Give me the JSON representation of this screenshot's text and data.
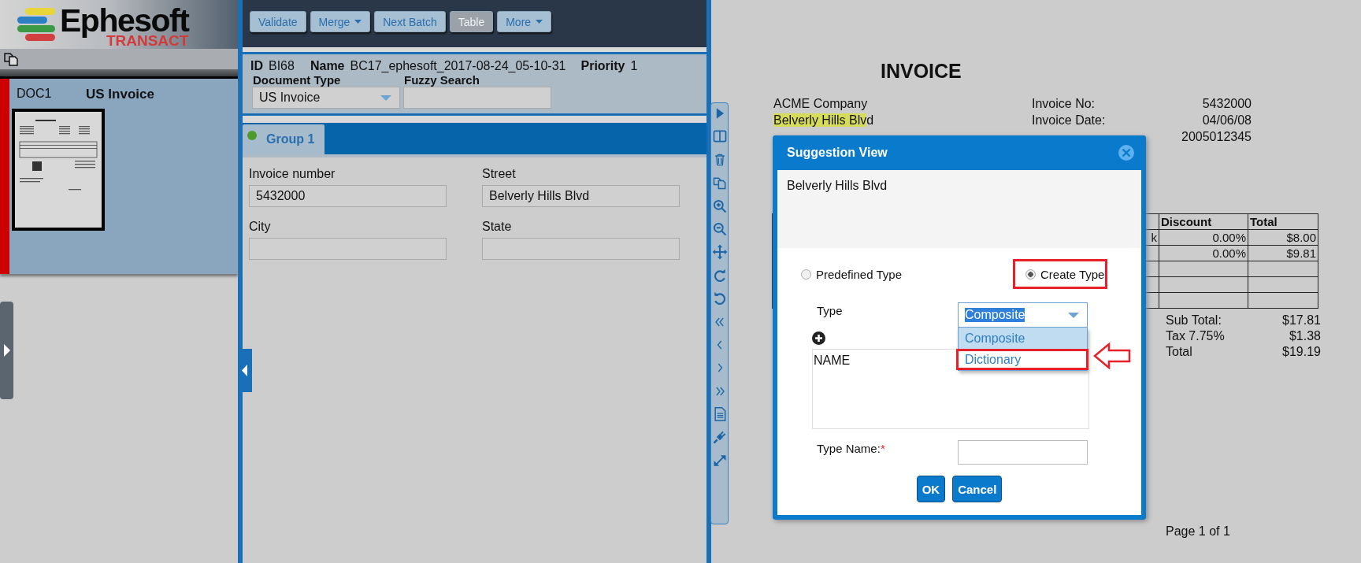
{
  "logo": {
    "name": "Ephesoft",
    "product": "TRANSACT"
  },
  "documents": [
    {
      "id": "DOC1",
      "type": "US Invoice",
      "selected": true
    }
  ],
  "toolbar": {
    "buttons": [
      {
        "label": "Validate",
        "dropdown": false,
        "disabled": false
      },
      {
        "label": "Merge",
        "dropdown": true,
        "disabled": false
      },
      {
        "label": "Next Batch",
        "dropdown": false,
        "disabled": false
      },
      {
        "label": "Table",
        "dropdown": false,
        "disabled": true
      },
      {
        "label": "More",
        "dropdown": true,
        "disabled": false
      }
    ]
  },
  "batch_info": {
    "id_label": "ID",
    "id": "BI68",
    "name_label": "Name",
    "name": "BC17_ephesoft_2017-08-24_05-10-31",
    "priority_label": "Priority",
    "priority": "1",
    "document_type_label": "Document Type",
    "document_type": "US Invoice",
    "fuzzy_search_label": "Fuzzy Search"
  },
  "group_tabs": [
    {
      "label": "Group 1",
      "selected": true
    }
  ],
  "fields": [
    {
      "label": "Invoice number",
      "value": "5432000"
    },
    {
      "label": "Street",
      "value": "Belverly Hills Blvd"
    },
    {
      "label": "City"
    },
    {
      "label": "State"
    }
  ],
  "document": {
    "title": "INVOICE",
    "address": [
      [
        {
          "text": "ACME Company",
          "highlighted": false
        }
      ],
      [
        {
          "text": "Belverly Hills Blv",
          "highlighted": true
        },
        {
          "text": "d",
          "highlighted": false
        }
      ]
    ],
    "details": [
      {
        "label": "Invoice No:",
        "value": "5432000"
      },
      {
        "label": "Invoice Date:",
        "value": "04/06/08"
      },
      {
        "value": "2005012345"
      }
    ],
    "table": {
      "columns": [
        "Discount",
        "Total"
      ],
      "rows": [
        {
          "column_1": "k",
          "discount": "0.00%",
          "total": "$8.00"
        },
        {
          "discount": "0.00%",
          "total": "$9.81"
        },
        {},
        {},
        {}
      ]
    },
    "totals": [
      {
        "label": "Sub Total:",
        "value": "$17.81"
      },
      {
        "label": "Tax 7.75%",
        "value": "$1.38"
      },
      {
        "label": "Total",
        "value": "$19.19"
      }
    ],
    "page": "Page 1 of 1"
  },
  "dialog": {
    "title": "Suggestion View",
    "suggestion": "Belverly Hills Blvd",
    "options": [
      {
        "label": "Predefined Type",
        "selected": false,
        "annotated": false
      },
      {
        "label": "Create Type",
        "selected": true,
        "annotated": true
      }
    ],
    "type_label": "Type",
    "type_value": "Composite",
    "type_options": [
      {
        "label": "Composite",
        "selected": true,
        "annotated": false
      },
      {
        "label": "Dictionary",
        "selected": false,
        "annotated": true
      }
    ],
    "list_items": [
      "NAME"
    ],
    "type_name_label": "Type Name:",
    "required_mark": "*",
    "buttons": [
      "OK",
      "Cancel"
    ]
  }
}
